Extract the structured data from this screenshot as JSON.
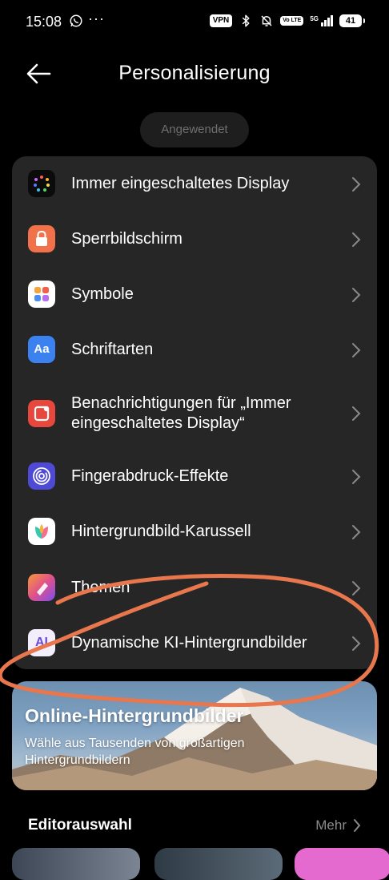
{
  "status_bar": {
    "time": "15:08",
    "dots": "···",
    "vpn": "VPN",
    "volte": "Vo LTE",
    "network": "5G",
    "battery": "41"
  },
  "header": {
    "title": "Personalisierung",
    "applied_label": "Angewendet"
  },
  "settings_list": {
    "items": [
      {
        "label": "Immer eingeschaltetes Display",
        "icon": "always-on-display-icon"
      },
      {
        "label": "Sperrbildschirm",
        "icon": "lock-screen-icon"
      },
      {
        "label": "Symbole",
        "icon": "app-icons-icon"
      },
      {
        "label": "Schriftarten",
        "icon": "fonts-icon",
        "icon_text": "Aa"
      },
      {
        "label": "Benachrichtigungen für „Immer eingeschaltetes Display“",
        "icon": "notification-icon"
      },
      {
        "label": "Fingerabdruck-Effekte",
        "icon": "fingerprint-icon"
      },
      {
        "label": "Hintergrundbild-Karussell",
        "icon": "wallpaper-carousel-icon"
      },
      {
        "label": "Themen",
        "icon": "themes-icon"
      },
      {
        "label": "Dynamische KI-Hintergrundbilder",
        "icon": "ai-wallpaper-icon",
        "icon_text": "AI"
      }
    ]
  },
  "banner": {
    "title": "Online-Hintergrundbilder",
    "subtitle": "Wähle aus Tausenden von großartigen Hintergrundbildern"
  },
  "editor_picks": {
    "title": "Editorauswahl",
    "more_label": "Mehr"
  },
  "colors": {
    "background": "#000000",
    "card": "#262626",
    "annotation_stroke": "#e8774d",
    "muted_text": "#8a8a8a"
  }
}
